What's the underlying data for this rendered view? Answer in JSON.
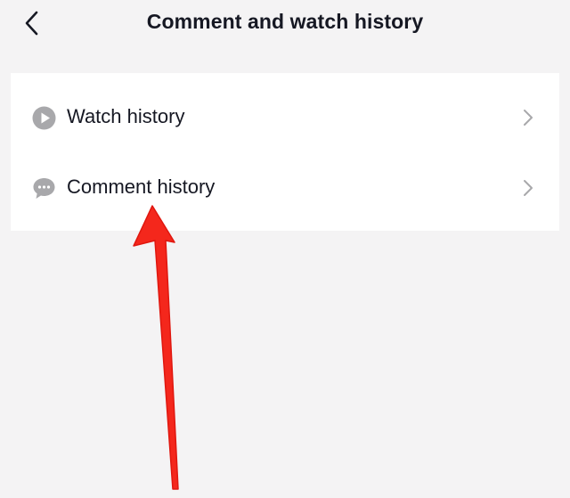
{
  "header": {
    "title": "Comment and watch history",
    "back_icon": "chevron-left-icon"
  },
  "menu": {
    "items": [
      {
        "label": "Watch history",
        "icon": "play-circle-icon",
        "trailing_icon": "chevron-right-icon"
      },
      {
        "label": "Comment history",
        "icon": "speech-bubble-icon",
        "trailing_icon": "chevron-right-icon"
      }
    ]
  },
  "annotation": {
    "type": "arrow",
    "points_to": "Comment history",
    "color": "#f4271c"
  },
  "colors": {
    "background": "#f4f3f4",
    "card": "#ffffff",
    "text": "#161823",
    "icon": "#a8a8ab",
    "chevron": "#a8a8ab",
    "arrow": "#f4271c"
  }
}
